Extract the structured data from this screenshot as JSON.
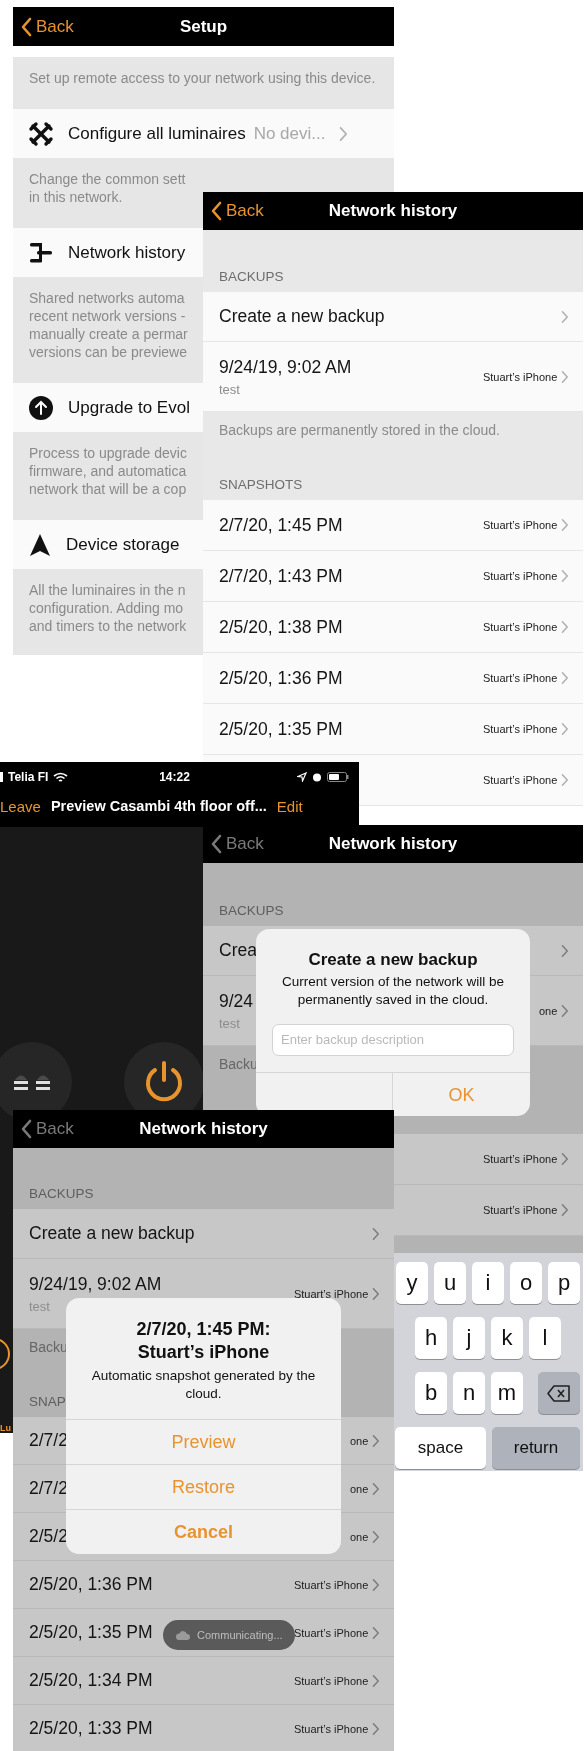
{
  "setup": {
    "back": "Back",
    "title": "Setup",
    "intro": "Set up remote access to your network using this device.",
    "sections": [
      {
        "label": "Configure all luminaires",
        "value": "No devi...",
        "lines": [
          "Change the common sett",
          "in this network."
        ]
      },
      {
        "label": "Network history",
        "lines": [
          "Shared networks automa",
          "recent network versions -",
          "manually create a permar",
          "versions can be previewe"
        ]
      },
      {
        "label": "Upgrade to Evol",
        "lines": [
          "Process to upgrade devic",
          "firmware, and automatica",
          "network that will be a cop"
        ]
      },
      {
        "label": "Device storage",
        "lines": [
          "All the luminaires in the n",
          "configuration. Adding mo",
          "and timers to the network"
        ]
      }
    ]
  },
  "history_top": {
    "back": "Back",
    "title": "Network history",
    "dimmed": false,
    "backups_header": "BACKUPS",
    "create": "Create a new backup",
    "backup": {
      "date": "9/24/19, 9:02 AM",
      "note": "test",
      "device": "Stuart’s iPhone"
    },
    "footer": "Backups are permanently stored in the cloud.",
    "snapshots_header": "SNAPSHOTS",
    "snapshots": [
      {
        "date": "2/7/20, 1:45 PM",
        "device": "Stuart’s iPhone"
      },
      {
        "date": "2/7/20, 1:43 PM",
        "device": "Stuart’s iPhone"
      },
      {
        "date": "2/5/20, 1:38 PM",
        "device": "Stuart’s iPhone"
      },
      {
        "date": "2/5/20, 1:36 PM",
        "device": "Stuart’s iPhone"
      },
      {
        "date": "2/5/20, 1:35 PM",
        "device": "Stuart’s iPhone"
      },
      {
        "device": "Stuart’s iPhone"
      }
    ]
  },
  "preview": {
    "carrier": "Telia FI",
    "time": "14:22",
    "leave": "Leave",
    "title": "Preview Casambi 4th floor off...",
    "edit": "Edit",
    "bottom_label": "Lu"
  },
  "history_backup_dialog": {
    "back": "Back",
    "title": "Network history",
    "dimmed": true,
    "backups_header": "BACKUPS",
    "create": "Crea",
    "backup": {
      "date": "9/24",
      "note": "test",
      "device": "one"
    },
    "footer": "Backu",
    "snapshots": [
      {
        "device": "Stuart’s iPhone"
      },
      {
        "device": "Stuart’s iPhone"
      }
    ],
    "alert": {
      "title": "Create a new backup",
      "message": "Current version of the network will be permanently saved in the cloud.",
      "placeholder": "Enter backup description",
      "ok": "OK"
    },
    "keyboard": {
      "rows": [
        [
          "y",
          "u",
          "i",
          "o",
          "p"
        ],
        [
          "h",
          "j",
          "k",
          "l"
        ],
        [
          "b",
          "n",
          "m"
        ]
      ],
      "space": "space",
      "return": "return"
    }
  },
  "history_snapshot_dialog": {
    "back": "Back",
    "title": "Network history",
    "dimmed": true,
    "backups_header": "BACKUPS",
    "create": "Create a new backup",
    "backup": {
      "date": "9/24/19, 9:02 AM",
      "note": "test",
      "device": "Stuart’s iPhone"
    },
    "footer": "Backu",
    "snapshots_header": "SNAP",
    "snapshots": [
      {
        "date": "2/7/2",
        "device": "one"
      },
      {
        "date": "2/7/2",
        "device": "one"
      },
      {
        "date": "2/5/2",
        "device": "one"
      },
      {
        "date": "2/5/20, 1:36 PM",
        "device": "Stuart’s iPhone"
      },
      {
        "date": "2/5/20, 1:35 PM",
        "device": "Stuart’s iPhone"
      },
      {
        "date": "2/5/20, 1:34 PM",
        "device": "Stuart’s iPhone"
      },
      {
        "date": "2/5/20, 1:33 PM",
        "device": "Stuart’s iPhone"
      }
    ],
    "alert": {
      "title": "2/7/20, 1:45 PM:\nStuart’s iPhone",
      "message": "Automatic snapshot generated by the cloud.",
      "actions": [
        "Preview",
        "Restore",
        "Cancel"
      ]
    },
    "toast": "Communicating..."
  }
}
